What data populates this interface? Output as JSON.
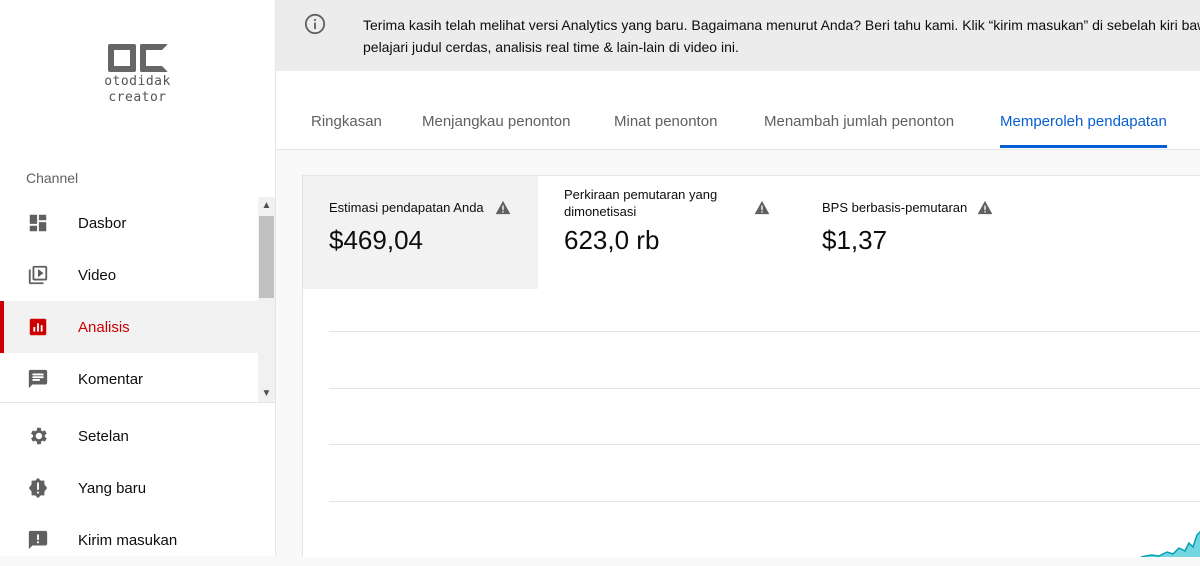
{
  "sidebar": {
    "logo": {
      "mark": "OC",
      "line1": "otodidak",
      "line2": "creator"
    },
    "section_label": "Channel",
    "items": [
      {
        "label": "Dasbor",
        "icon": "dashboard-icon"
      },
      {
        "label": "Video",
        "icon": "video-library-icon"
      },
      {
        "label": "Analisis",
        "icon": "analytics-icon",
        "active": true
      },
      {
        "label": "Komentar",
        "icon": "comment-icon"
      }
    ],
    "lower_items": [
      {
        "label": "Setelan",
        "icon": "gear-icon"
      },
      {
        "label": "Yang baru",
        "icon": "whats-new-icon"
      },
      {
        "label": "Kirim masukan",
        "icon": "feedback-icon"
      }
    ]
  },
  "banner": {
    "icon": "info-icon",
    "line1": "Terima kasih telah melihat versi Analytics yang baru. Bagaimana menurut Anda? Beri tahu kami. Klik “kirim masukan” di sebelah kiri baw",
    "line2": "pelajari judul cerdas, analisis real time & lain-lain di video ini."
  },
  "tabs": [
    {
      "label": "Ringkasan"
    },
    {
      "label": "Menjangkau penonton"
    },
    {
      "label": "Minat penonton"
    },
    {
      "label": "Menambah jumlah penonton"
    },
    {
      "label": "Memperoleh pendapatan",
      "active": true
    }
  ],
  "metrics": [
    {
      "label": "Estimasi pendapatan Anda",
      "value": "$469,04",
      "icon": "warning-icon"
    },
    {
      "label_line1": "Perkiraan pemutaran yang",
      "label_line2": "dimonetisasi",
      "value": "623,0 rb",
      "icon": "warning-icon"
    },
    {
      "label": "BPS berbasis-pemutaran",
      "value": "$1,37",
      "icon": "warning-icon"
    }
  ],
  "colors": {
    "accent_red": "#cc0000",
    "tab_blue": "#065fd4",
    "chart_teal": "#00b4c8"
  }
}
